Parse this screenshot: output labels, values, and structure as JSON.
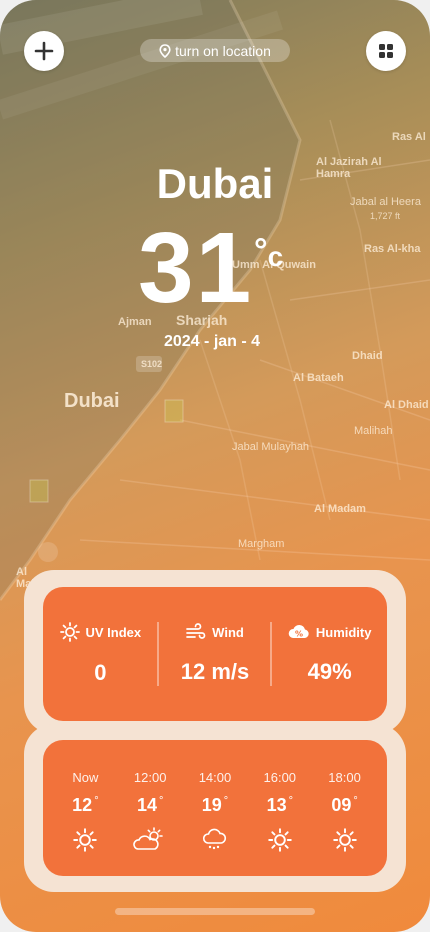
{
  "top_bar": {
    "add_icon": "plus-icon",
    "location_label": "turn on location",
    "menu_icon": "grid-icon"
  },
  "map": {
    "labels": [
      "Ras Al",
      "Al Jazirah Al Hamra",
      "Jabal al Heera",
      "1,727 ft",
      "Ras Al-kha",
      "Umm Al Quwain",
      "Ajman",
      "Sharjah",
      "S102",
      "Dhaid",
      "Al Bataeh",
      "Dubai",
      "Al Dhaid",
      "Malihah",
      "Jabal Mulayhah",
      "Al Madam",
      "Margham",
      "Al Maktoum"
    ]
  },
  "weather": {
    "city": "Dubai",
    "temperature": "31",
    "unit": "c",
    "date": "2024 - jan - 4"
  },
  "stats": [
    {
      "label": "UV Index",
      "value": "0",
      "icon": "sun-icon"
    },
    {
      "label": "Wind",
      "value": "12 m/s",
      "icon": "wind-icon"
    },
    {
      "label": "Humidity",
      "value": "49%",
      "icon": "humidity-icon"
    }
  ],
  "hourly": [
    {
      "time": "Now",
      "temp": "12",
      "icon": "sun-icon"
    },
    {
      "time": "12:00",
      "temp": "14",
      "icon": "partly-cloudy-icon"
    },
    {
      "time": "14:00",
      "temp": "19",
      "icon": "rain-cloud-icon"
    },
    {
      "time": "16:00",
      "temp": "13",
      "icon": "sun-icon"
    },
    {
      "time": "18:00",
      "temp": "09",
      "icon": "sun-icon"
    }
  ],
  "colors": {
    "accent": "#f2723b",
    "card_bg": "#f5e3d3"
  }
}
